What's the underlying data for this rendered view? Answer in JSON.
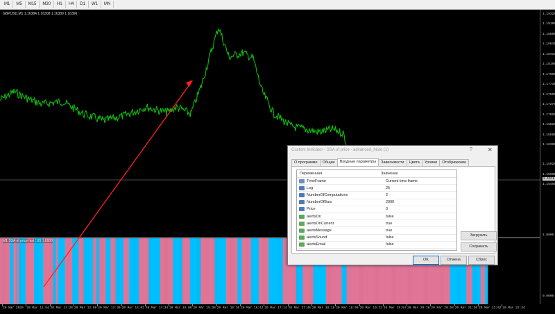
{
  "timeframes": [
    "M1",
    "M5",
    "M15",
    "M30",
    "H1",
    "H4",
    "D1",
    "W1",
    "MN"
  ],
  "chart": {
    "title": "GBPUSD,M1  1.16384  1.16308  1.16389  1.16396",
    "price_labels": [
      "1.19320",
      "1.19100",
      "1.18880",
      "1.18645",
      "1.18415",
      "1.18190",
      "1.17960",
      "1.17730",
      "1.17505",
      "1.17275",
      "1.17050",
      "1.16820",
      "1.16590",
      "1.16360",
      "1.15925",
      "1.15685",
      "1.15455"
    ],
    "current_price": "1.16184",
    "indicator_title": "M1 SSA of price hist (10) 1.0000",
    "indicator_labels": [
      "1.0000",
      "0.0000"
    ],
    "time_labels": [
      "20 Mar 2020",
      "20 Mar 11:54",
      "20 Mar 12:26",
      "20 Mar 12:58",
      "20 Mar 13:30",
      "20 Mar 14:02",
      "20 Mar 14:34",
      "20 Mar 15:06",
      "20 Mar 15:38",
      "20 Mar 16:10",
      "20 Mar 16:42",
      "20 Mar 17:14",
      "20 Mar 17:46",
      "20 Mar 18:18",
      "20 Mar 18:50",
      "20 Mar 19:22",
      "20 Mar 19:54",
      "20 Mar 20:26",
      "20 Mar 20:58",
      "20 Mar 21:30",
      "20 Mar 22:02",
      "20 Mar 22:34"
    ],
    "colors": {
      "up": "#0bbf0b",
      "pink": "#e07597",
      "cyan": "#00bfff",
      "arrow": "#ff2020"
    },
    "histogram": [
      1,
      1,
      1,
      1,
      1,
      1,
      1,
      1,
      1,
      1,
      1,
      1,
      1,
      1,
      0,
      0,
      0,
      0,
      0,
      1,
      1,
      1,
      1,
      0,
      1,
      1,
      1,
      0,
      0,
      0,
      0,
      0,
      0,
      0,
      0,
      0,
      1,
      1,
      1,
      1,
      1,
      1,
      1,
      1,
      1,
      1,
      1,
      1,
      0,
      0,
      0,
      0,
      0,
      0,
      0,
      0,
      0,
      0,
      0,
      0,
      0,
      1,
      1,
      1,
      1,
      1,
      1,
      1,
      1,
      1,
      1,
      1,
      1,
      1,
      1,
      0,
      0,
      0,
      0,
      1,
      1,
      1,
      0,
      0,
      0,
      0,
      0,
      0,
      0,
      0,
      0,
      0,
      1,
      1,
      1,
      1,
      1,
      1,
      1,
      1,
      1,
      1,
      0,
      0,
      0,
      0,
      0,
      0,
      0,
      0,
      0,
      1,
      1,
      1,
      1,
      1,
      1,
      1,
      0,
      0,
      0,
      0,
      0,
      0,
      0,
      0,
      0,
      0,
      0,
      0,
      0,
      1,
      1,
      1,
      1,
      1,
      0,
      0,
      0,
      0,
      1,
      1,
      1,
      1,
      1,
      1,
      1,
      1,
      1,
      0,
      0,
      0,
      0,
      0,
      0,
      0,
      1,
      1,
      1,
      1,
      1,
      1,
      1,
      0,
      0,
      0,
      0,
      0,
      0,
      0,
      0,
      0,
      0,
      0,
      1,
      1,
      1,
      1,
      1,
      1,
      1,
      1,
      0,
      0,
      0,
      0,
      0,
      0,
      0,
      0,
      0,
      0,
      0,
      0,
      0,
      0,
      1,
      1,
      1,
      1,
      1,
      1,
      1,
      1,
      1,
      1,
      1,
      1,
      1,
      1,
      0,
      0,
      0,
      0,
      0,
      0,
      0,
      0,
      0,
      0,
      0,
      0,
      0,
      0,
      0,
      0,
      1,
      1,
      1,
      1,
      1,
      1,
      1,
      1,
      1,
      1,
      1,
      1,
      1,
      1,
      1,
      1,
      1,
      1,
      0,
      0,
      0,
      0,
      0,
      0,
      0,
      0,
      0,
      0,
      0,
      0,
      0,
      1,
      1,
      1,
      1,
      1,
      1,
      1,
      1,
      1,
      1,
      1,
      0,
      0,
      0,
      0,
      0,
      0,
      0,
      0,
      0,
      0,
      0,
      0,
      0,
      0,
      0,
      1,
      1,
      1,
      1,
      1,
      1,
      1,
      1,
      1,
      1,
      1,
      1,
      1,
      1,
      1,
      1,
      1,
      1,
      1,
      1,
      0,
      0,
      0,
      0,
      0,
      0,
      0,
      0,
      0,
      0,
      0,
      0,
      0,
      0,
      0,
      0,
      1,
      1,
      1,
      1,
      1,
      1,
      1,
      1,
      1,
      1,
      1,
      1,
      1,
      1,
      1,
      1,
      0,
      0,
      0,
      0,
      0,
      0,
      1,
      1,
      1,
      1,
      1,
      1,
      1,
      1,
      1,
      1,
      1,
      1,
      1,
      0,
      0,
      0,
      0,
      0,
      0,
      0,
      0,
      0,
      0,
      0,
      1,
      1,
      1,
      1,
      1,
      1,
      1,
      1,
      1,
      1,
      1,
      1,
      1,
      1,
      0,
      0,
      0,
      0,
      0,
      0,
      0,
      0,
      0,
      0,
      0,
      0,
      0,
      0,
      0,
      0,
      0,
      0,
      0,
      0,
      1,
      1,
      1,
      1,
      1,
      1,
      1,
      1,
      1,
      1,
      1,
      1,
      1,
      1,
      1,
      1,
      1,
      1,
      1,
      0,
      0,
      0,
      0,
      0,
      0,
      0,
      0,
      0,
      1,
      1,
      1,
      1,
      1,
      1,
      1,
      1,
      1,
      1,
      1,
      1,
      1,
      1,
      1,
      0,
      0,
      0,
      0,
      0,
      0,
      0,
      0,
      0,
      0,
      0,
      0,
      0,
      0,
      0,
      0,
      0,
      0,
      1,
      1,
      1,
      1,
      1,
      1,
      1,
      1,
      1,
      1,
      1,
      1,
      1,
      1,
      1,
      1,
      1,
      1,
      1,
      1,
      1,
      1,
      0,
      0,
      0,
      0,
      0,
      0,
      0,
      1,
      1,
      1,
      1,
      1,
      1,
      1,
      1,
      1,
      1,
      1,
      1,
      1,
      1,
      1,
      1,
      1,
      1,
      1,
      1,
      1,
      1,
      1,
      1,
      1,
      1,
      1,
      1,
      1,
      1,
      1,
      1,
      1,
      1,
      1,
      1,
      1,
      1,
      1,
      1,
      1,
      1,
      1,
      1,
      1,
      1,
      1,
      1,
      1,
      1,
      1,
      1,
      1,
      1,
      1,
      1,
      1,
      1,
      1,
      1,
      1,
      1,
      1,
      1,
      1,
      1,
      1,
      1,
      1,
      1,
      1,
      1,
      1,
      1,
      1,
      1,
      1,
      1,
      1,
      1,
      1,
      1,
      1,
      1,
      1,
      1,
      1,
      1,
      1,
      1,
      1,
      1,
      1,
      1,
      1,
      1,
      1,
      1,
      1,
      1,
      1,
      1,
      1,
      1,
      1,
      1,
      1,
      1,
      1,
      1,
      1,
      1,
      1,
      1,
      1,
      1,
      1,
      1,
      1,
      1,
      1,
      1,
      1,
      1,
      1,
      1,
      1,
      1,
      1,
      1,
      1,
      1,
      1,
      1,
      1,
      1,
      1,
      1,
      1,
      1,
      1,
      1,
      1,
      1,
      1,
      1,
      0,
      0,
      0,
      0,
      0,
      0,
      0,
      0,
      0,
      0,
      0,
      0,
      0,
      0,
      0,
      0,
      0,
      0,
      0,
      0,
      0,
      0,
      0,
      1,
      1,
      1,
      1,
      1,
      1,
      1,
      1,
      0,
      0,
      0,
      0,
      0,
      0,
      0,
      0,
      0,
      0,
      0,
      0,
      1,
      1,
      1,
      1,
      1,
      1,
      0,
      0,
      0,
      0
    ]
  },
  "dialog": {
    "title": "Custom Indicator - SSA of price - advanced_histo (1)",
    "help": "?",
    "close": "✕",
    "tabs": [
      "О программе",
      "Общие",
      "Входные параметры",
      "Зависимости",
      "Цвета",
      "Уровни",
      "Отображение"
    ],
    "active_tab": 2,
    "columns": [
      "Переменная",
      "Значение"
    ],
    "params": [
      {
        "icon": "ab",
        "name": "TimeFrame",
        "value": "Current time frame"
      },
      {
        "icon": "123",
        "name": "Log",
        "value": "25"
      },
      {
        "icon": "123",
        "name": "NumberOfComputations",
        "value": "2"
      },
      {
        "icon": "123",
        "name": "NumberOfBars",
        "value": "2000"
      },
      {
        "icon": "123",
        "name": "Price",
        "value": "0"
      },
      {
        "icon": "bool",
        "name": "alertsOn",
        "value": "false"
      },
      {
        "icon": "bool",
        "name": "alertsOnCurrent",
        "value": "true"
      },
      {
        "icon": "bool",
        "name": "alertsMessage",
        "value": "true"
      },
      {
        "icon": "bool",
        "name": "alertsSound",
        "value": "false"
      },
      {
        "icon": "bool",
        "name": "alertsEmail",
        "value": "false"
      }
    ],
    "load_label": "Загрузить",
    "save_label": "Сохранить",
    "ok_label": "OK",
    "cancel_label": "Отмена",
    "reset_label": "Сброс"
  }
}
